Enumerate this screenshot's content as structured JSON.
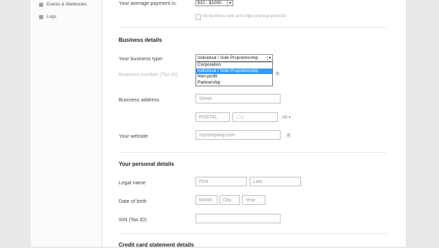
{
  "sidebar": {
    "items": [
      {
        "label": "Events & Webhooks",
        "icon": "events-icon"
      },
      {
        "label": "Logs",
        "icon": "logs-icon"
      }
    ]
  },
  "payment": {
    "label": "Your average payment is:",
    "value": "$10 - $1000",
    "checkbox_label": "My business sells and ships physical products"
  },
  "business": {
    "heading": "Business details",
    "type_label": "Your business type:",
    "type_value": "Individual / Sole Proprietorship",
    "type_options": [
      "Corporation",
      "Individual / Sole Proprietorship",
      "Non-profit",
      "Partnership"
    ],
    "type_selected_index": 1,
    "number_label": "Business number (Tax ID)",
    "address_label": "Business address",
    "street_placeholder": "Street",
    "postal_placeholder": "POSTAL",
    "city_placeholder": "City",
    "province_value": "AB",
    "website_label": "Your website",
    "website_placeholder": "mycompany.com"
  },
  "personal": {
    "heading": "Your personal details",
    "legal_name_label": "Legal name",
    "first_placeholder": "First",
    "last_placeholder": "Last",
    "dob_label": "Date of birth",
    "month_placeholder": "Month",
    "day_placeholder": "Day",
    "year_placeholder": "Year",
    "sin_label": "SIN (Tax ID)"
  },
  "statement": {
    "heading": "Credit card statement details"
  }
}
